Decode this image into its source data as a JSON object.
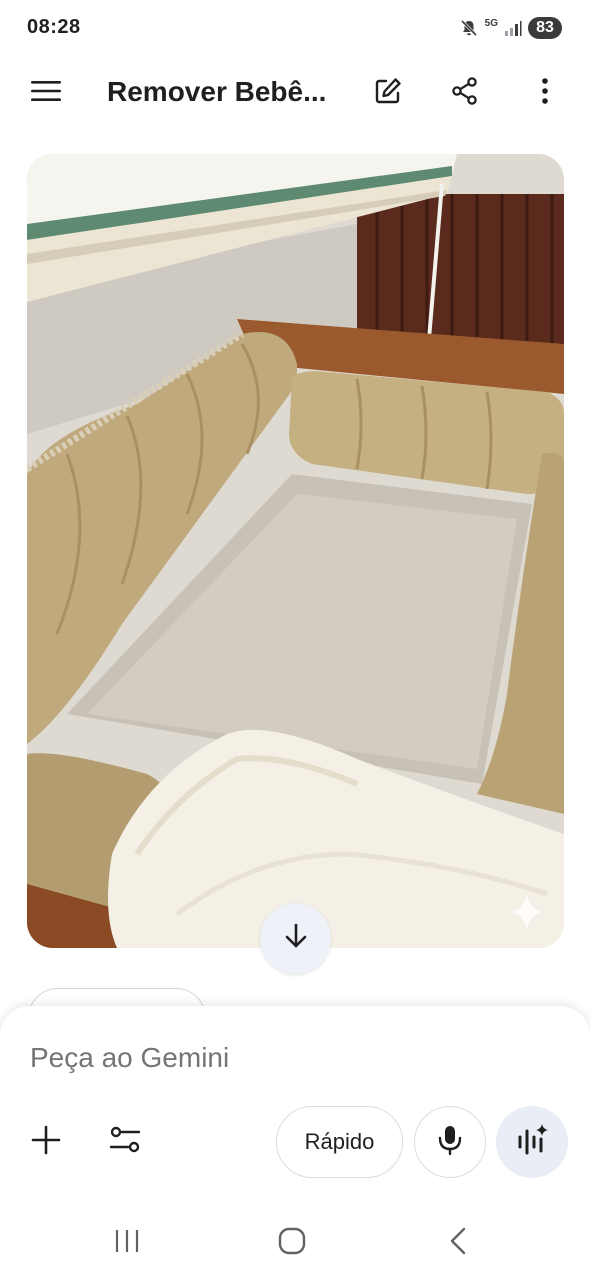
{
  "status_bar": {
    "time": "08:28",
    "network_label": "5G",
    "battery_level": "83",
    "icons": [
      "mute-icon",
      "network-5g-icon",
      "signal-icon",
      "battery-icon"
    ]
  },
  "app_bar": {
    "title": "Remover Bebê...",
    "icons": {
      "menu": "menu-icon",
      "edit": "edit-icon",
      "share": "share-icon",
      "more": "more-vertical-icon"
    }
  },
  "content": {
    "image_icons": [
      "scroll-down-icon",
      "sparkle-icon"
    ]
  },
  "input": {
    "placeholder": "Peça ao Gemini",
    "mode_label": "Rápido",
    "icons": {
      "add": "add-icon",
      "tools": "tools-icon",
      "mic": "mic-icon",
      "live": "gemini-live-icon"
    }
  },
  "nav_bar": {
    "icons": [
      "recent-apps-icon",
      "home-icon",
      "back-icon"
    ]
  },
  "colors": {
    "background": "#ffffff",
    "text_primary": "#1f1f1f",
    "text_placeholder": "#5f6368",
    "chip_border": "#dadce0",
    "live_button_bg": "#e8edf6",
    "scroll_button_bg": "#eef1f7",
    "battery_pill": "#3a3a3a"
  }
}
